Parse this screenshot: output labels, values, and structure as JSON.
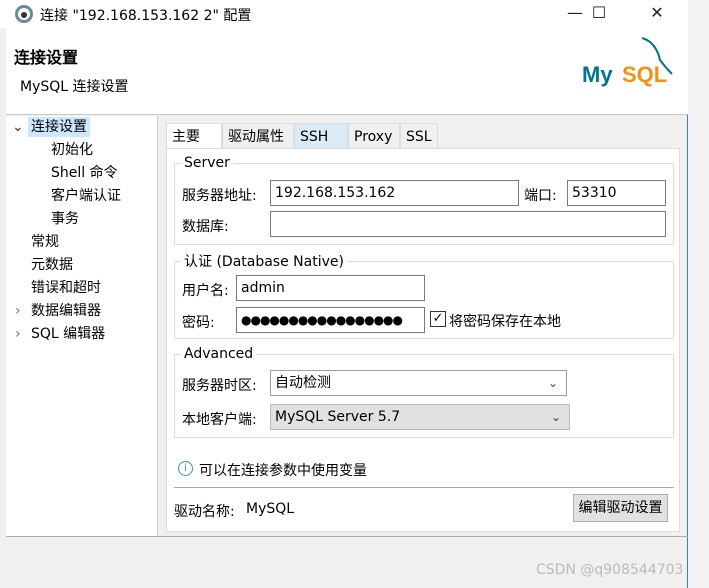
{
  "window": {
    "title": "连接 \"192.168.153.162 2\" 配置",
    "minimize": "—",
    "maximize": "☐",
    "close": "✕"
  },
  "header": {
    "title": "连接设置",
    "subtitle": "MySQL 连接设置",
    "logo": "MySQL"
  },
  "tree": {
    "items": [
      {
        "label": "连接设置",
        "expander": "⌄",
        "selected": true
      },
      {
        "label": "初始化"
      },
      {
        "label": "Shell 命令"
      },
      {
        "label": "客户端认证"
      },
      {
        "label": "事务"
      },
      {
        "label": "常规"
      },
      {
        "label": "元数据"
      },
      {
        "label": "错误和超时"
      },
      {
        "label": "数据编辑器",
        "expander": "›"
      },
      {
        "label": "SQL 编辑器",
        "expander": "›"
      }
    ]
  },
  "tabs": [
    {
      "label": "主要",
      "active": true
    },
    {
      "label": "驱动属性"
    },
    {
      "label": "SSH",
      "highlight": true
    },
    {
      "label": "Proxy"
    },
    {
      "label": "SSL"
    }
  ],
  "server": {
    "legend": "Server",
    "host_label": "服务器地址:",
    "host": "192.168.153.162",
    "port_label": "端口:",
    "port": "53310",
    "db_label": "数据库:",
    "db": ""
  },
  "auth": {
    "legend": "认证 (Database Native)",
    "user_label": "用户名:",
    "user": "admin",
    "pass_label": "密码:",
    "pass": "●●●●●●●●●●●●●●●●●",
    "save_label": "将密码保存在本地",
    "save_checked": true
  },
  "advanced": {
    "legend": "Advanced",
    "tz_label": "服务器时区:",
    "tz": "自动检测",
    "client_label": "本地客户端:",
    "client": "MySQL Server 5.7"
  },
  "info": "可以在连接参数中使用变量",
  "driver": {
    "label": "驱动名称:",
    "name": "MySQL",
    "edit_button": "编辑驱动设置"
  },
  "watermark": "CSDN @q908544703",
  "colors": {
    "accent": "#cce8ff",
    "mysql_blue": "#00758f",
    "mysql_orange": "#f29111"
  }
}
